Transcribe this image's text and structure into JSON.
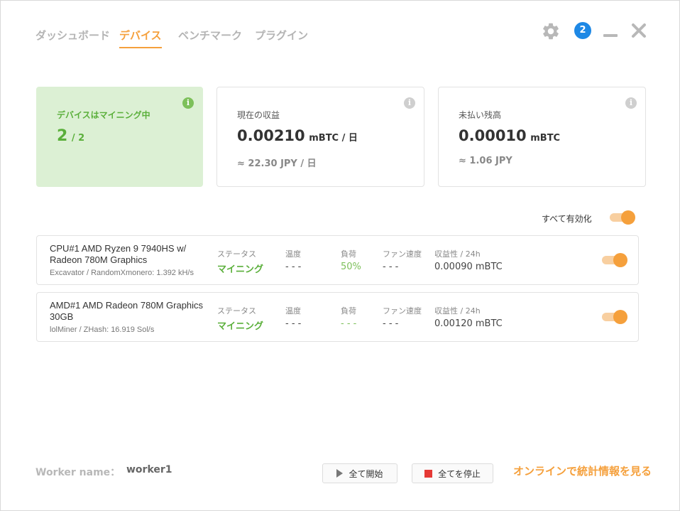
{
  "tabs": [
    {
      "label": "ダッシュボード",
      "active": false
    },
    {
      "label": "デバイス",
      "active": true
    },
    {
      "label": "ベンチマーク",
      "active": false
    },
    {
      "label": "プラグイン",
      "active": false
    }
  ],
  "header": {
    "notifications_count": "2",
    "icons": [
      "gear-icon",
      "notification-badge",
      "minimize-icon",
      "close-icon"
    ]
  },
  "cards": {
    "mining": {
      "label": "デバイスはマイニング中",
      "count": "2",
      "total": "/ 2",
      "info": "i"
    },
    "profit": {
      "label": "現在の収益",
      "value": "0.00210",
      "unit": "mBTC / 日",
      "sub": "≈ 22.30 JPY / 日",
      "info": "i"
    },
    "unpaid": {
      "label": "未払い残高",
      "value": "0.00010",
      "unit": "mBTC",
      "sub": "≈ 1.06 JPY",
      "info": "i"
    }
  },
  "enable_all": {
    "label": "すべて有効化",
    "on": true
  },
  "columns": {
    "status": "ステータス",
    "temp": "温度",
    "load": "負荷",
    "fan": "ファン速度",
    "profit": "収益性 / 24h"
  },
  "devices": [
    {
      "name": "CPU#1 AMD Ryzen 9 7940HS w/ Radeon 780M Graphics",
      "algo": "Excavator / RandomXmonero: 1.392 kH/s",
      "status": "マイニング",
      "temp": "- - -",
      "load": "50%",
      "fan": "- - -",
      "profit": "0.00090 mBTC",
      "enabled": true
    },
    {
      "name": "AMD#1 AMD Radeon 780M Graphics 30GB",
      "algo": "lolMiner / ZHash: 16.919 Sol/s",
      "status": "マイニング",
      "temp": "- - -",
      "load": "- - -",
      "fan": "- - -",
      "profit": "0.00120 mBTC",
      "enabled": true
    }
  ],
  "footer": {
    "worker_label": "Worker name：",
    "worker_value": "worker1",
    "start_all": "全て開始",
    "stop_all": "全てを停止",
    "online_link": "オンラインで統計情報を見る"
  },
  "colors": {
    "accent": "#f5a03c",
    "green": "#5aaf3a",
    "badge": "#1e88e5",
    "stop": "#e53935"
  }
}
